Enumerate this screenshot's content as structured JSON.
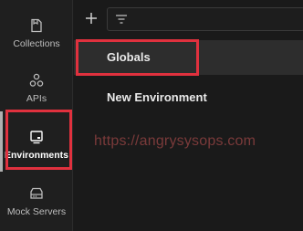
{
  "sidebar": {
    "items": [
      {
        "label": "Collections",
        "icon": "collections-icon"
      },
      {
        "label": "APIs",
        "icon": "apis-icon"
      },
      {
        "label": "Environments",
        "icon": "environments-icon",
        "active": true
      },
      {
        "label": "Mock Servers",
        "icon": "mock-servers-icon"
      }
    ]
  },
  "toolbar": {
    "add_icon": "plus-icon",
    "filter_icon": "filter-icon"
  },
  "environments": {
    "rows": [
      {
        "label": "Globals",
        "selected": true
      },
      {
        "label": "New Environment"
      }
    ]
  },
  "watermark": "https://angrysysops.com",
  "colors": {
    "highlight": "#e0313e",
    "selected_row": "#2d2d2d",
    "watermark": "#7a3a3a"
  }
}
